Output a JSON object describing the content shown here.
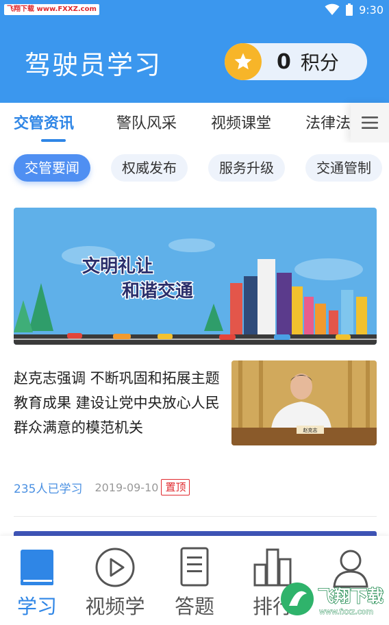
{
  "status_bar": {
    "watermark": "飞翔下载 www.FXXZ.com",
    "time": "9:30"
  },
  "header": {
    "title": "驾驶员学习",
    "points_value": "0",
    "points_unit": "积分"
  },
  "tabs": [
    {
      "label": "交管资讯",
      "active": true
    },
    {
      "label": "警队风采",
      "active": false
    },
    {
      "label": "视频课堂",
      "active": false
    },
    {
      "label": "法律法",
      "active": false
    }
  ],
  "chips": [
    {
      "label": "交管要闻",
      "active": true
    },
    {
      "label": "权威发布",
      "active": false
    },
    {
      "label": "服务升级",
      "active": false
    },
    {
      "label": "交通管制",
      "active": false
    }
  ],
  "banner": {
    "line1": "文明礼让",
    "line2": "和谐交通"
  },
  "article": {
    "title": "赵克志强调 不断巩固和拓展主题教育成果 建设让党中央放心人民群众满意的模范机关",
    "learners": "235人已学习",
    "date": "2019-09-10",
    "pin": "置顶",
    "nameplate": "赵克志"
  },
  "bottom_nav": [
    {
      "label": "学习",
      "icon": "book-icon",
      "active": true
    },
    {
      "label": "视频学",
      "icon": "play-icon",
      "active": false
    },
    {
      "label": "答题",
      "icon": "document-icon",
      "active": false
    },
    {
      "label": "排行",
      "icon": "ranking-icon",
      "active": false
    },
    {
      "label": "",
      "icon": "user-icon",
      "active": false
    }
  ],
  "watermark_bottom": {
    "text": "飞翔下载",
    "url": "www.fxxz.com"
  },
  "colors": {
    "primary": "#3b97ee",
    "accent": "#2f86e6",
    "star": "#f7b529",
    "pin": "#e0282d"
  }
}
